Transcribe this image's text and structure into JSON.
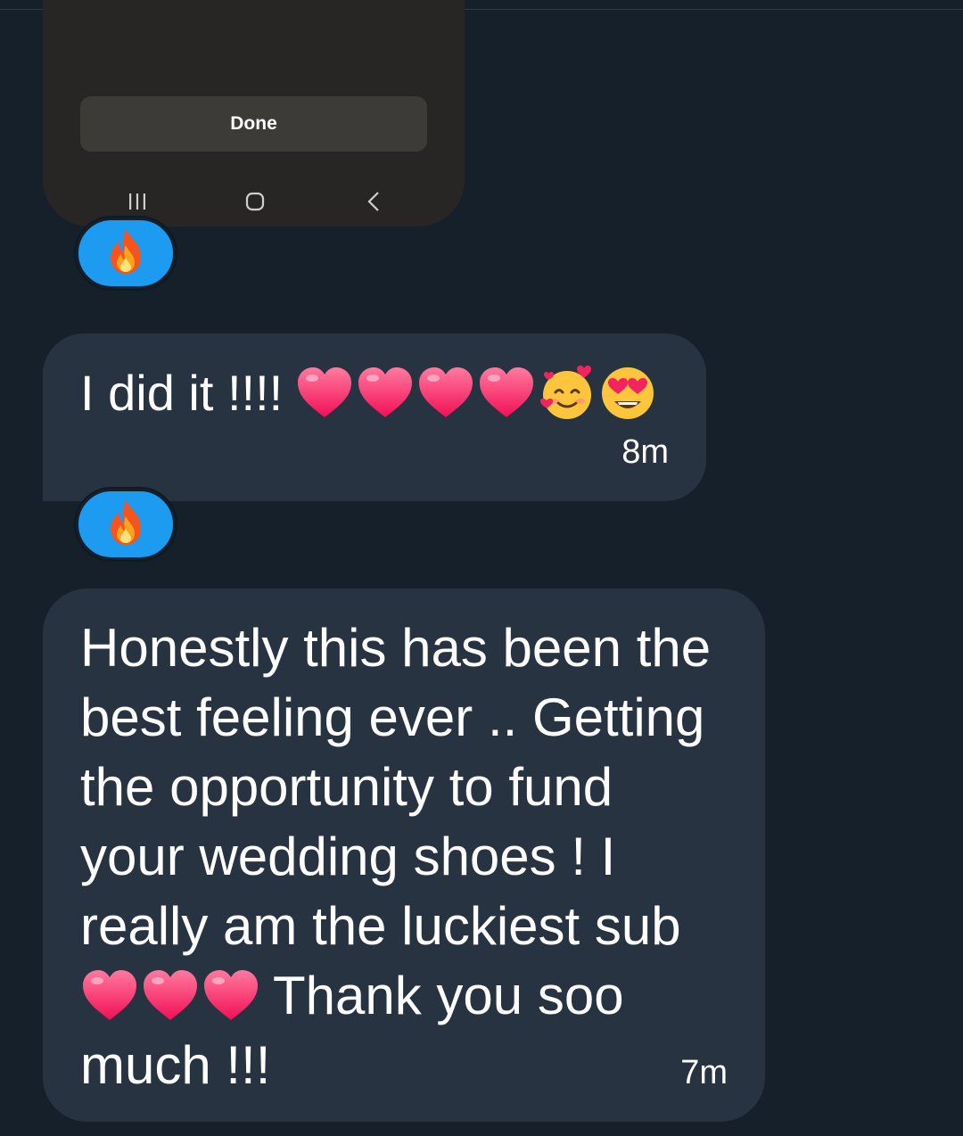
{
  "shared_screenshot": {
    "done_label": "Done"
  },
  "reactions": [
    {
      "emoji": "fire-icon"
    },
    {
      "emoji": "fire-icon"
    }
  ],
  "messages": [
    {
      "text": "I did it !!!!",
      "emojis": [
        "heart-icon",
        "heart-icon",
        "heart-icon",
        "heart-icon",
        "smiling-face-with-hearts-icon",
        "heart-eyes-icon"
      ],
      "time": "8m"
    },
    {
      "lines": [
        "Honestly this has been the",
        "best feeling ever .. Getting",
        "the opportunity to fund",
        "your wedding shoes ! I",
        "really am the luckiest sub",
        "Thank you soo",
        "much !!!"
      ],
      "emojis": [
        "heart-icon",
        "heart-icon",
        "heart-icon"
      ],
      "time": "7m"
    }
  ],
  "colors": {
    "background": "#15202b",
    "bubble": "#273340",
    "reaction_pill": "#1d9bf0",
    "card": "#272624"
  }
}
